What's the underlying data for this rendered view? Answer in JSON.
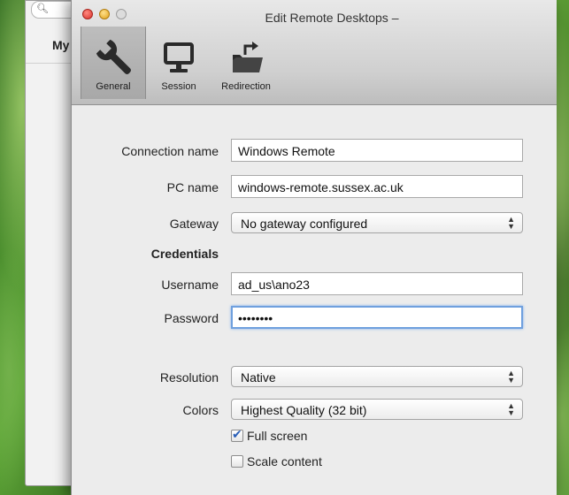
{
  "background_window": {
    "search_icon": "search-icon",
    "title": "My"
  },
  "window": {
    "title": "Edit Remote Desktops –"
  },
  "tabs": [
    {
      "label": "General",
      "icon": "wrench-icon",
      "active": true
    },
    {
      "label": "Session",
      "icon": "monitor-icon",
      "active": false
    },
    {
      "label": "Redirection",
      "icon": "folder-redirect-icon",
      "active": false
    }
  ],
  "form": {
    "connection_name_label": "Connection name",
    "connection_name_value": "Windows Remote",
    "pc_name_label": "PC name",
    "pc_name_value": "windows-remote.sussex.ac.uk",
    "gateway_label": "Gateway",
    "gateway_value": "No gateway configured",
    "credentials_heading": "Credentials",
    "username_label": "Username",
    "username_value": "ad_us\\ano23",
    "password_label": "Password",
    "password_value": "••••••••",
    "resolution_label": "Resolution",
    "resolution_value": "Native",
    "colors_label": "Colors",
    "colors_value": "Highest Quality (32 bit)",
    "full_screen_label": "Full screen",
    "full_screen_checked": true,
    "scale_content_label": "Scale content",
    "scale_content_checked": false
  },
  "colors": {
    "focus_ring": "#6fa0de",
    "close_button": "#d9302a",
    "minimize_button": "#e0a11a"
  }
}
